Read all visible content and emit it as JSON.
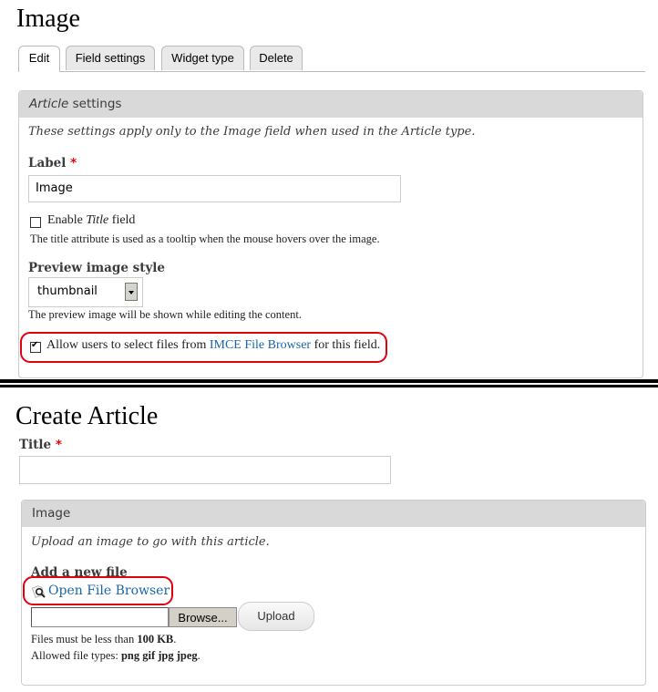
{
  "settings_page": {
    "title": "Image",
    "tabs": [
      {
        "label": "Edit",
        "active": true
      },
      {
        "label": "Field settings",
        "active": false
      },
      {
        "label": "Widget type",
        "active": false
      },
      {
        "label": "Delete",
        "active": false
      }
    ],
    "fieldset": {
      "legend_italic": "Article",
      "legend_rest": " settings",
      "description": "These settings apply only to the Image field when used in the Article type.",
      "label_field": {
        "label": "Label",
        "required_mark": "*",
        "value": "Image"
      },
      "enable_title": {
        "checked": false,
        "label_pre": "Enable ",
        "label_italic": "Title",
        "label_post": " field",
        "help": "The title attribute is used as a tooltip when the mouse hovers over the image."
      },
      "preview_style": {
        "label": "Preview image style",
        "selected": "thumbnail",
        "help": "The preview image will be shown while editing the content."
      },
      "imce": {
        "checked": true,
        "label_pre": "Allow users to select files from ",
        "link_text": "IMCE File Browser",
        "label_post": " for this field."
      }
    }
  },
  "create_page": {
    "title": "Create Article",
    "title_field": {
      "label": "Title",
      "required_mark": "*",
      "value": ""
    },
    "image_fieldset": {
      "legend": "Image",
      "description": "Upload an image to go with this article.",
      "add_label": "Add a new file",
      "open_browser_link": "Open File Browser",
      "browse_button": "Browse...",
      "upload_button": "Upload",
      "size_note_pre": "Files must be less than ",
      "size_note_value": "100 KB",
      "size_note_post": ".",
      "types_note_pre": "Allowed file types: ",
      "types_note_value": "png gif jpg jpeg",
      "types_note_post": "."
    }
  },
  "colors": {
    "link": "#1a65a8",
    "highlight_box": "#e4000f",
    "required": "#e00000",
    "legend_bg": "#d9d9d9"
  }
}
